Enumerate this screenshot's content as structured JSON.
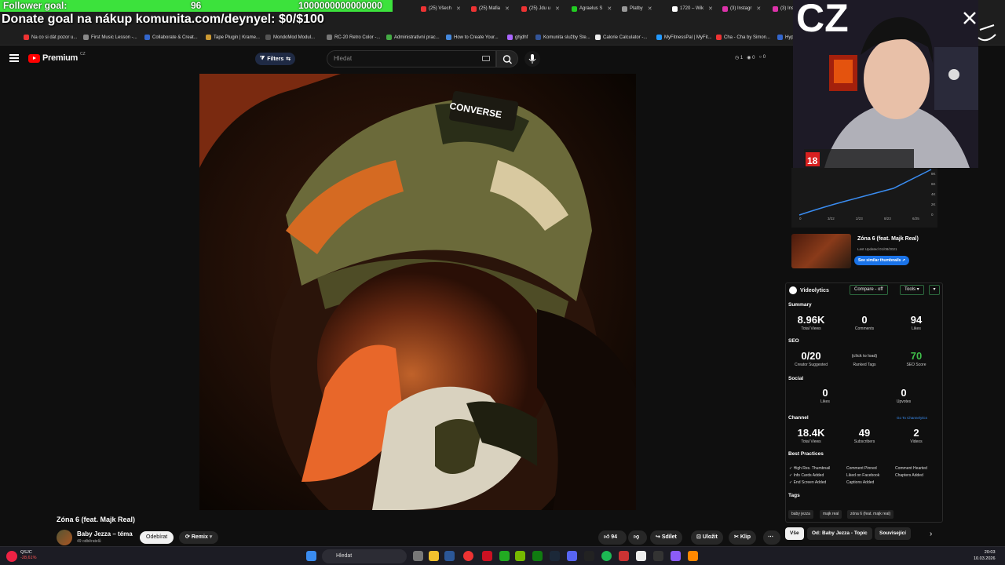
{
  "overlay": {
    "follower_goal_label": "Follower goal:",
    "follower_goal_current": "96",
    "follower_goal_target": "1000000000000000",
    "donate_text": "Donate goal na nákup komunita.com/deynyel: $0/$100",
    "webcam_text": "CZ"
  },
  "browser": {
    "tabs": [
      "(25) Všech",
      "(25) Mafia",
      "(25) Jdu u",
      "Agraelus S",
      "Platby",
      "1720 – Wik",
      "(3) Instagr",
      "(3) Ins"
    ],
    "bookmarks": [
      "Na co si dát pozor u...",
      "First Music Lesson -...",
      "Collaborate & Creat...",
      "Tape Plugin | Krame...",
      "MondoMod Modul...",
      "RC-20 Retro Color -...",
      "Administrativní prac...",
      "How to Create Your...",
      "ghjdhf",
      "Komunita služby Ste...",
      "Calorie Calculator -...",
      "MyFitnessPal | MyFit...",
      "Cha - Cha by Simon...",
      "Hyp"
    ]
  },
  "youtube": {
    "logo_word": "Premium",
    "logo_region": "CZ",
    "filters_label": "Filters",
    "search_placeholder": "Hledat",
    "header_stats": [
      "1",
      "0",
      "0"
    ]
  },
  "video": {
    "title": "Zóna 6 (feat. Majk Real)",
    "channel": "Baby Jezza – téma",
    "subscribers": "49 odběratelů",
    "unsubscribe_label": "Odebírat",
    "remix_label": "Remix",
    "likes": "94",
    "share_label": "Sdílet",
    "save_label": "Uložit",
    "clip_label": "Klip"
  },
  "chips": [
    "Vše",
    "Od: Baby Jezza - Topic",
    "Související"
  ],
  "thumbnail_card": {
    "title": "Zóna 6 (feat. Majk Real)",
    "updated": "Last Updated 01/08/2021",
    "similar_button": "See similar thumbnails"
  },
  "graph": {
    "y_ticks": [
      "8K",
      "6K",
      "4K",
      "2K",
      "0"
    ],
    "x_ticks": [
      "0",
      "3/22",
      "2/23",
      "8/23",
      "6/25"
    ]
  },
  "videolytics": {
    "brand": "Videolytics",
    "compare_label": "Compare - off",
    "tools_label": "Tools",
    "summary_title": "Summary",
    "summary": [
      {
        "value": "8.96K",
        "label": "Total Views"
      },
      {
        "value": "0",
        "label": "Comments"
      },
      {
        "value": "94",
        "label": "Likes"
      }
    ],
    "seo_title": "SEO",
    "seo": [
      {
        "value": "0/20",
        "label": "Creator Suggested"
      },
      {
        "value": "(click to load)",
        "label": "Ranked Tags"
      },
      {
        "value": "70",
        "label": "SEO Score"
      }
    ],
    "social_title": "Social",
    "social": [
      {
        "value": "0",
        "label": "Likes"
      },
      {
        "value": "0",
        "label": "Upvotes"
      }
    ],
    "channel_title": "Channel",
    "channel_link": "Go To Channelytics",
    "channel": [
      {
        "value": "18.4K",
        "label": "Total Views"
      },
      {
        "value": "49",
        "label": "Subscribers"
      },
      {
        "value": "2",
        "label": "Videos"
      }
    ],
    "best_practices_title": "Best Practices",
    "best_practices": [
      "High Res. Thumbnail",
      "Comment Pinned",
      "Comment Hearted",
      "Info Cards Added",
      "Liked on Facebook",
      "Chapters Added",
      "End Screen Added",
      "Captions Added"
    ],
    "tags_title": "Tags",
    "tags": [
      "baby jezza",
      "majk real",
      "zóna 6 (feat. majk real)"
    ]
  },
  "taskbar": {
    "search_placeholder": "Hledat",
    "stock_name": "QSJC",
    "stock_change": "-28,61%",
    "time": "20:03",
    "date": "10.03.2026"
  },
  "colors": {
    "overlay_green": "#3ce23c",
    "yt_red": "#ff0000",
    "seo_score_green": "#3fbf4a",
    "accent_blue": "#1a73e8"
  }
}
